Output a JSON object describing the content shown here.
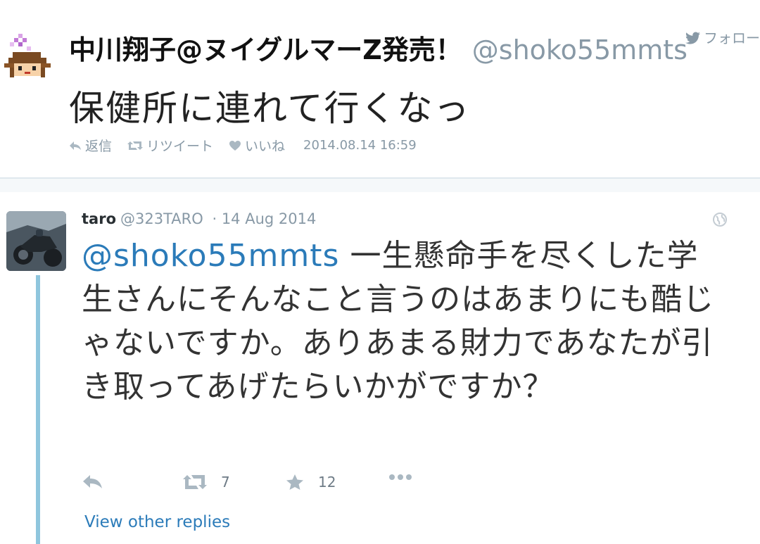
{
  "tweet": {
    "name": "中川翔子@ヌイグルマーZ発売！",
    "handle": "@shoko55mmts",
    "follow_label": "フォロー",
    "text": "保健所に連れて行くなっ",
    "actions": {
      "reply": "返信",
      "retweet": "リツイート",
      "like": "いいね"
    },
    "timestamp": "2014.08.14 16:59"
  },
  "reply": {
    "name": "taro",
    "handle": "@323TARO",
    "date": "· 14 Aug 2014",
    "mention": "@shoko55mmts",
    "text": " 一生懸命手を尽くした学生さんにそんなこと言うのはあまりにも酷じゃないですか。ありあまる財力であなたが引き取ってあげたらいかがですか？",
    "retweet_count": "7",
    "favorite_count": "12",
    "view_other_replies": "View other replies"
  },
  "colors": {
    "link": "#2b7bb9",
    "muted": "#8899a6",
    "thread_line": "#8fc6dd"
  }
}
